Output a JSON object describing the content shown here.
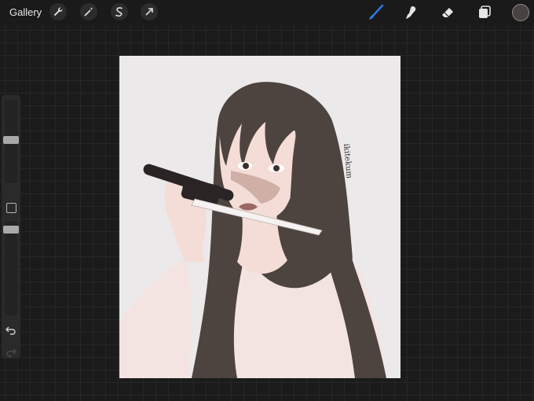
{
  "toolbar": {
    "gallery_label": "Gallery",
    "left_tools": [
      "wrench-icon",
      "magic-wand-icon",
      "selection-icon",
      "transform-arrow-icon"
    ],
    "right_tools": [
      "brush-icon",
      "smudge-icon",
      "eraser-icon",
      "layers-icon"
    ],
    "active_tool": "brush-icon",
    "active_color": "#4a4240",
    "accent": "#2f7be0"
  },
  "sidebar": {
    "controls": [
      "brush-size-slider",
      "modify-button",
      "opacity-slider",
      "undo-icon",
      "redo-icon"
    ],
    "brush_size_level": 0.52,
    "opacity_level": 0.95
  },
  "canvas": {
    "signature": "ikitekum",
    "palette": {
      "background": "#ebe9ea",
      "hair": "#4d433f",
      "skin": "#f3ddd6",
      "robe": "#f4e4e1",
      "lips": "#9a6864",
      "blade": "#f6f2f1",
      "handle": "#2a2425"
    }
  }
}
